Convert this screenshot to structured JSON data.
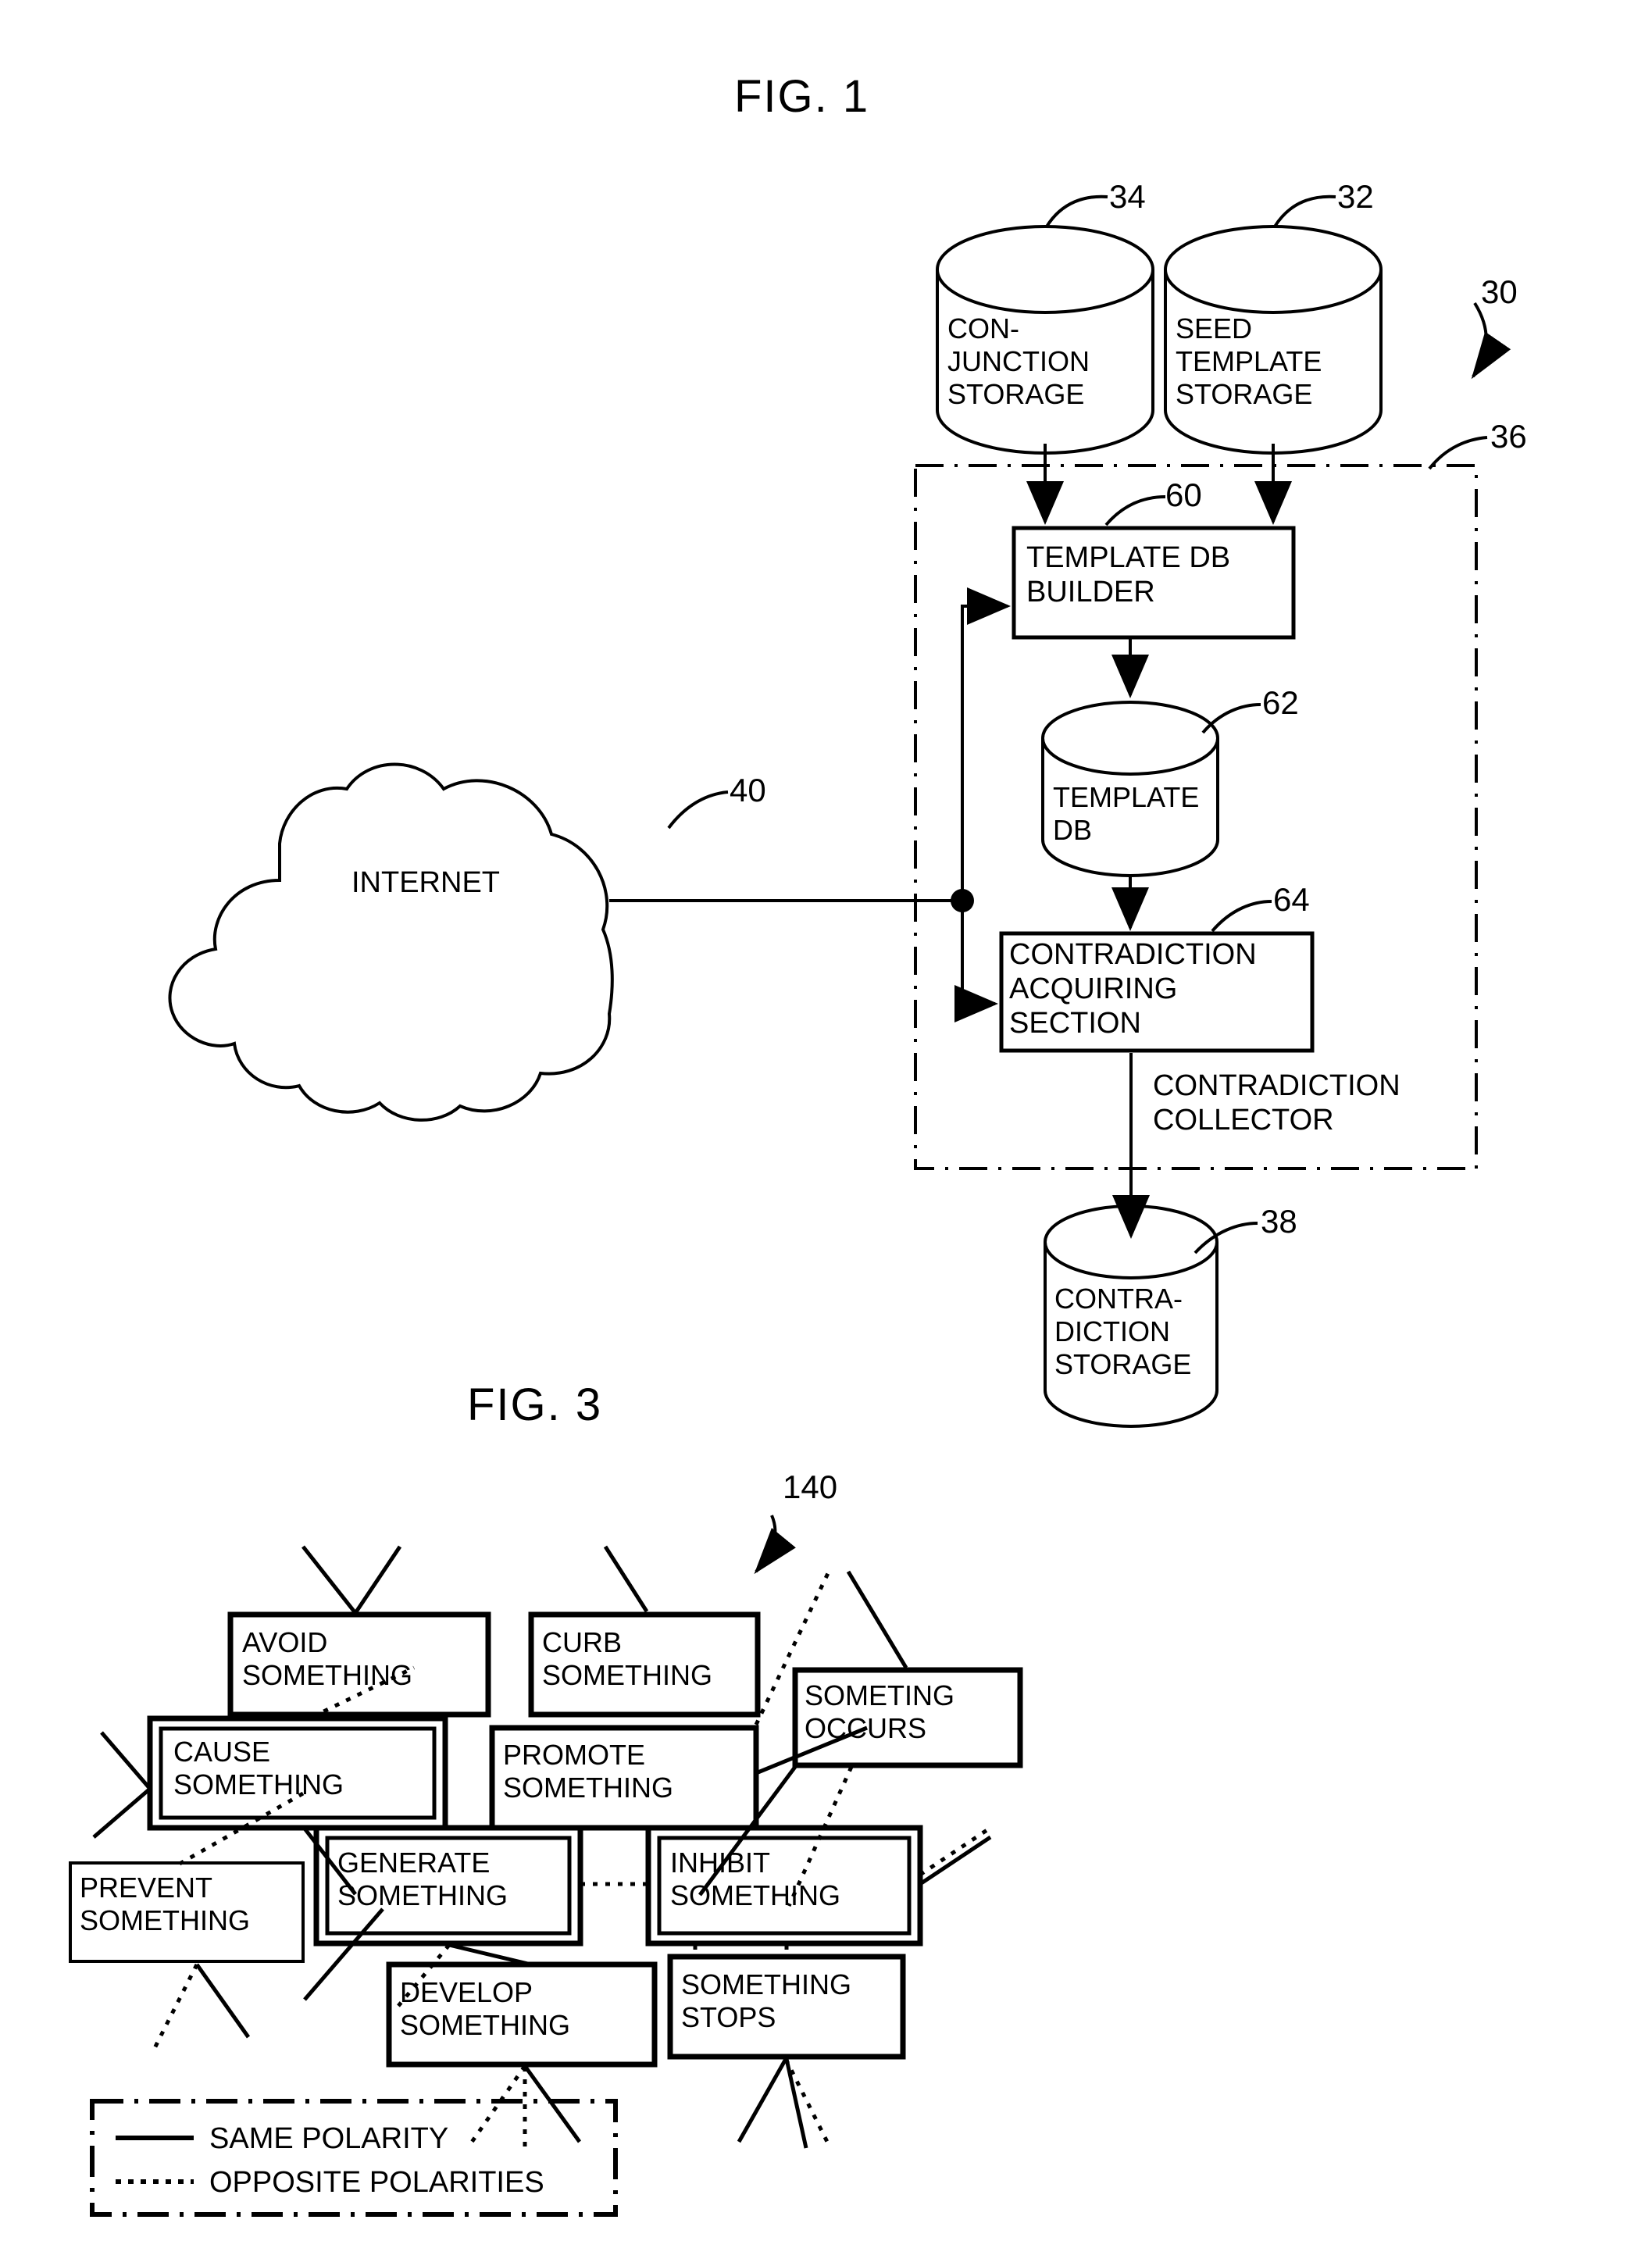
{
  "figures": {
    "fig1": {
      "title": "FIG. 1",
      "system_ref": "30",
      "collector_box_ref": "36",
      "collector_box_label": "CONTRADICTION\nCOLLECTOR",
      "cylinders": [
        {
          "id": "conjunction-storage",
          "ref": "34",
          "label": "CON-\nJUNCTION\nSTORAGE"
        },
        {
          "id": "seed-template-storage",
          "ref": "32",
          "label": "SEED\nTEMPLATE\nSTORAGE"
        },
        {
          "id": "template-db",
          "ref": "62",
          "label": "TEMPLATE\nDB"
        },
        {
          "id": "contradiction-storage",
          "ref": "38",
          "label": "CONTRA-\nDICTION\nSTORAGE"
        }
      ],
      "boxes": [
        {
          "id": "template-db-builder",
          "ref": "60",
          "label": "TEMPLATE DB\nBUILDER"
        },
        {
          "id": "contradiction-acquiring-section",
          "ref": "64",
          "label": "CONTRADICTION\nACQUIRING\nSECTION"
        }
      ],
      "cloud": {
        "id": "internet-cloud",
        "ref": "40",
        "label": "INTERNET"
      }
    },
    "fig3": {
      "title": "FIG. 3",
      "graph_ref": "140",
      "nodes": [
        {
          "id": "avoid-something",
          "label": "AVOID\nSOMETHING",
          "border": "single"
        },
        {
          "id": "curb-something",
          "label": "CURB\nSOMETHING",
          "border": "single"
        },
        {
          "id": "someting-occurs",
          "label": "SOMETING\nOCCURS",
          "border": "single"
        },
        {
          "id": "cause-something",
          "label": "CAUSE\nSOMETHING",
          "border": "double"
        },
        {
          "id": "promote-something",
          "label": "PROMOTE\nSOMETHING",
          "border": "single"
        },
        {
          "id": "prevent-something",
          "label": "PREVENT\nSOMETHING",
          "border": "thin"
        },
        {
          "id": "generate-something",
          "label": "GENERATE\nSOMETHING",
          "border": "double"
        },
        {
          "id": "inhibit-something",
          "label": "INHIBIT\nSOMETHING",
          "border": "double"
        },
        {
          "id": "develop-something",
          "label": "DEVELOP\nSOMETHING",
          "border": "single"
        },
        {
          "id": "something-stops",
          "label": "SOMETHING\nSTOPS",
          "border": "single"
        }
      ],
      "legend": {
        "same_polarity": "SAME POLARITY",
        "opposite_polarities": "OPPOSITE POLARITIES"
      }
    }
  },
  "colors": {
    "ink": "#000000",
    "paper": "#ffffff"
  }
}
